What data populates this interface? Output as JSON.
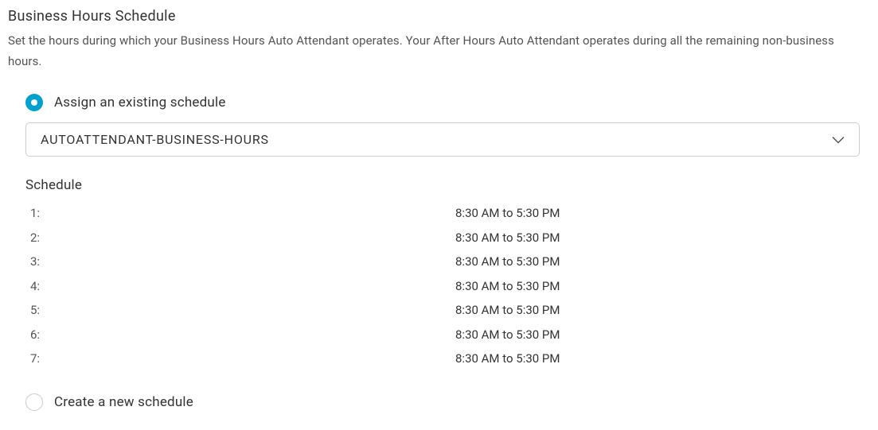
{
  "header": {
    "title": "Business Hours Schedule",
    "description": "Set the hours during which your Business Hours Auto Attendant operates. Your After Hours Auto Attendant operates during all the remaining non-business hours."
  },
  "options": {
    "assign_existing_label": "Assign an existing schedule",
    "create_new_label": "Create a new schedule"
  },
  "dropdown": {
    "selected_value": "AUTOATTENDANT-BUSINESS-HOURS"
  },
  "schedule": {
    "heading": "Schedule",
    "rows": [
      {
        "index": "1:",
        "time": "8:30 AM to 5:30 PM"
      },
      {
        "index": "2:",
        "time": "8:30 AM to 5:30 PM"
      },
      {
        "index": "3:",
        "time": "8:30 AM to 5:30 PM"
      },
      {
        "index": "4:",
        "time": "8:30 AM to 5:30 PM"
      },
      {
        "index": "5:",
        "time": "8:30 AM to 5:30 PM"
      },
      {
        "index": "6:",
        "time": "8:30 AM to 5:30 PM"
      },
      {
        "index": "7:",
        "time": "8:30 AM to 5:30 PM"
      }
    ]
  }
}
